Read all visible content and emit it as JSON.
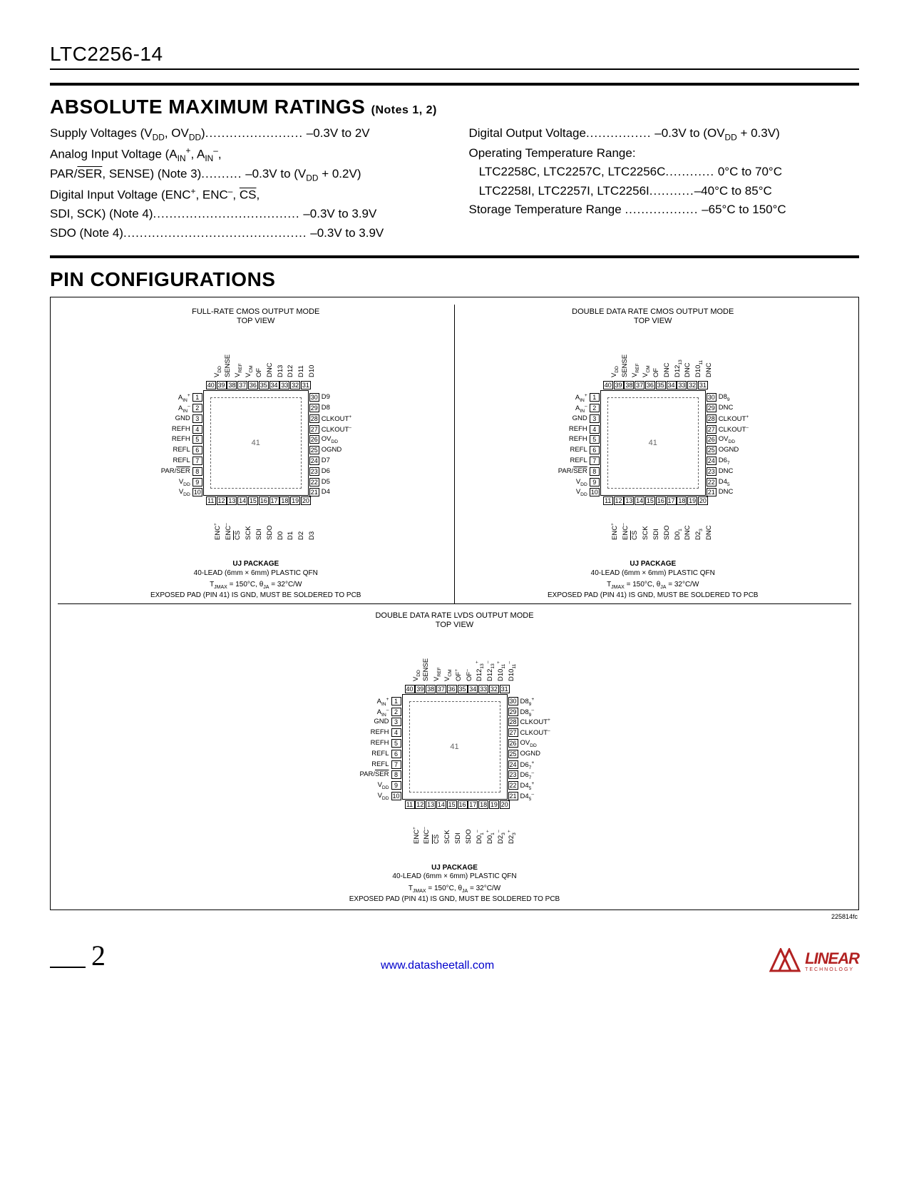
{
  "header": {
    "part": "LTC2256-14"
  },
  "sec_amr": {
    "title": "ABSOLUTE MAXIMUM RATINGS",
    "notes": "(Notes 1, 2)",
    "left": [
      {
        "label": "Supply Voltages (V_DD, OV_DD)",
        "value": "–0.3V to 2V"
      },
      {
        "label": "Analog Input Voltage (A_IN^+, A_IN^–, PAR/SER, SENSE) (Note 3)",
        "value": "–0.3V to (V_DD + 0.2V)"
      },
      {
        "label": "Digital Input Voltage (ENC^+, ENC^–, CS, SDI, SCK) (Note 4)",
        "value": "–0.3V to 3.9V"
      },
      {
        "label": "SDO (Note 4)",
        "value": "–0.3V to 3.9V"
      }
    ],
    "right": [
      {
        "label": "Digital Output Voltage",
        "value": "–0.3V to (OV_DD + 0.3V)"
      },
      {
        "label": "Operating Temperature Range:",
        "value": ""
      },
      {
        "label": "LTC2258C, LTC2257C, LTC2256C",
        "value": "0°C to 70°C",
        "indent": true
      },
      {
        "label": "LTC2258I, LTC2257I, LTC2256I",
        "value": "–40°C to 85°C",
        "indent": true
      },
      {
        "label": "Storage Temperature Range",
        "value": "–65°C to 150°C"
      }
    ]
  },
  "sec_pin": {
    "title": "PIN CONFIGURATIONS"
  },
  "packages": [
    {
      "title": "FULL-RATE CMOS OUTPUT MODE\nTOP VIEW",
      "left": [
        "A_IN^+",
        "A_IN^–",
        "GND",
        "REFH",
        "REFH",
        "REFL",
        "REFL",
        "PAR/SER",
        "V_DD",
        "V_DD"
      ],
      "right": [
        "D9",
        "D8",
        "CLKOUT^+",
        "CLKOUT^–",
        "OV_DD",
        "OGND",
        "D7",
        "D6",
        "D5",
        "D4"
      ],
      "top": [
        "V_DD",
        "SENSE",
        "V_REF",
        "V_CM",
        "OF",
        "DNC",
        "D13",
        "D12",
        "D11",
        "D10"
      ],
      "bottom": [
        "ENC^+",
        "ENC^–",
        "CS",
        "SCK",
        "SDI",
        "SDO",
        "D0",
        "D1",
        "D2",
        "D3"
      ]
    },
    {
      "title": "DOUBLE DATA RATE CMOS OUTPUT MODE\nTOP VIEW",
      "left": [
        "A_IN^+",
        "A_IN^–",
        "GND",
        "REFH",
        "REFH",
        "REFL",
        "REFL",
        "PAR/SER",
        "V_DD",
        "V_DD"
      ],
      "right": [
        "D8_9",
        "DNC",
        "CLKOUT^+",
        "CLKOUT^–",
        "OV_DD",
        "OGND",
        "D6_7",
        "DNC",
        "D4_5",
        "DNC"
      ],
      "top": [
        "V_DD",
        "SENSE",
        "V_REF",
        "V_CM",
        "OF",
        "DNC",
        "D12_13",
        "DNC",
        "D10_11",
        "DNC"
      ],
      "bottom": [
        "ENC^+",
        "ENC^–",
        "CS",
        "SCK",
        "SDI",
        "SDO",
        "D0_1",
        "DNC",
        "D2_3",
        "DNC"
      ]
    },
    {
      "title": "DOUBLE DATA RATE LVDS OUTPUT MODE\nTOP VIEW",
      "left": [
        "A_IN^+",
        "A_IN^–",
        "GND",
        "REFH",
        "REFH",
        "REFL",
        "REFL",
        "PAR/SER",
        "V_DD",
        "V_DD"
      ],
      "right": [
        "D8_9^+",
        "D8_9^–",
        "CLKOUT^+",
        "CLKOUT^–",
        "OV_DD",
        "OGND",
        "D6_7^+",
        "D6_7^–",
        "D4_5^+",
        "D4_5^–"
      ],
      "top": [
        "V_DD",
        "SENSE",
        "V_REF",
        "V_CM",
        "OF^+",
        "OF^–",
        "D12_13^+",
        "D12_13^–",
        "D10_11^+",
        "D10_11^–"
      ],
      "bottom": [
        "ENC^+",
        "ENC^–",
        "CS",
        "SCK",
        "SDI",
        "SDO",
        "D0_1^–",
        "D0_1^+",
        "D2_3^–",
        "D2_3^+"
      ]
    }
  ],
  "pkg_common": {
    "center": "41",
    "pkg_name": "UJ PACKAGE",
    "pkg_desc": "40-LEAD (6mm × 6mm) PLASTIC QFN",
    "thermal": "T_JMAX = 150°C, θ_JA = 32°C/W",
    "pad_note": "EXPOSED PAD (PIN 41) IS GND, MUST BE SOLDERED TO PCB"
  },
  "doc": {
    "code": "225814fc",
    "page": "2",
    "link": "www.datasheetall.com"
  }
}
